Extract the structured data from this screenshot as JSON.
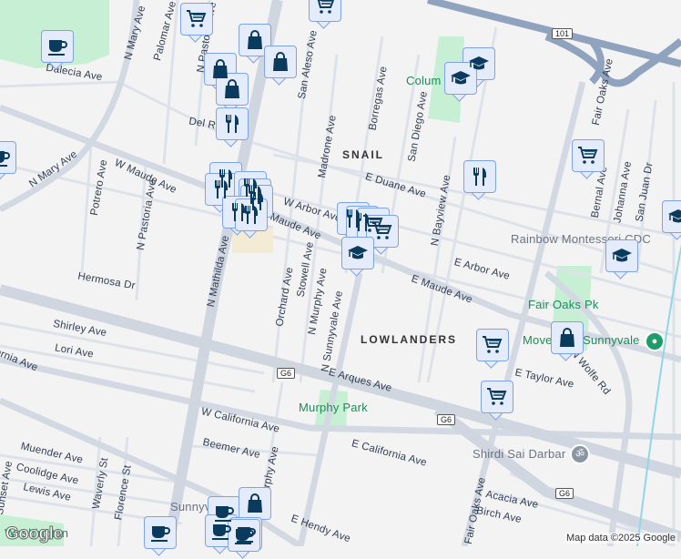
{
  "map": {
    "attribution": "Map data ©2025 Google",
    "logo": "Google"
  },
  "neighborhoods": [
    "SNAIL",
    "LOWLANDERS"
  ],
  "places": {
    "park1": "Colum",
    "park2": "Fair Oaks Pk",
    "gym": "Movement Sunnyvale",
    "park3": "Murphy Park",
    "park4": "Washington",
    "school": "Rainbow Montessori CDC",
    "temple": "Shirdi Sai Darbar",
    "town": "Sunnyvale"
  },
  "shields": [
    "101",
    "G6",
    "G6",
    "G6"
  ],
  "streets": [
    "N Mary Ave",
    "Palomar Ave",
    "N Pastoria Ave",
    "San Aleso Ave",
    "Dalecia Ave",
    "Del Rey Ave",
    "W Maude Ave",
    "Potrero Ave",
    "N Pastoria Ave",
    "W Arbor Ave",
    "Madrone Ave",
    "Borregas Ave",
    "San Diego Ave",
    "E Duane Ave",
    "N Bayview Ave",
    "Fair Oaks Ave",
    "Bernal Ave",
    "Johanna Ave",
    "San Juan Dr",
    "E Arbor Ave",
    "E Maude Ave",
    "E Taylor Ave",
    "N Wolfe Rd",
    "E Arques Ave",
    "E California Ave",
    "Acacia Ave",
    "Birch Ave",
    "Fair Oaks Ave",
    "Hermosa Dr",
    "Shirley Ave",
    "Lori Ave",
    "California Ave",
    "W California Ave",
    "Beemer Ave",
    "Muender Ave",
    "Coolidge Ave",
    "Lewis Ave",
    "Waverly St",
    "Florence St",
    "Sunset Ave",
    "N Mathilda Ave",
    "Orchard Ave",
    "Stowell Ave",
    "N Murphy Ave",
    "N Sunnyvale Ave",
    "Murphy Ave",
    "E Hendy Ave",
    "N Mary Ave",
    "Maude Ave"
  ],
  "markers": [
    {
      "icon": "cup"
    },
    {
      "icon": "cart"
    },
    {
      "icon": "bag"
    },
    {
      "icon": "bag"
    },
    {
      "icon": "bag"
    },
    {
      "icon": "bag"
    },
    {
      "icon": "cutlery"
    },
    {
      "icon": "cutlery"
    },
    {
      "icon": "cutlery"
    },
    {
      "icon": "cutlery"
    },
    {
      "icon": "cutlery"
    },
    {
      "icon": "cutlery"
    },
    {
      "icon": "cutlery"
    },
    {
      "icon": "cutlery"
    },
    {
      "icon": "cup"
    },
    {
      "icon": "cart"
    },
    {
      "icon": "cap"
    },
    {
      "icon": "cap"
    },
    {
      "icon": "cutlery"
    },
    {
      "icon": "cart"
    },
    {
      "icon": "cap"
    },
    {
      "icon": "cap"
    },
    {
      "icon": "cutlery"
    },
    {
      "icon": "cutlery"
    },
    {
      "icon": "cart"
    },
    {
      "icon": "cart"
    },
    {
      "icon": "cap"
    },
    {
      "icon": "cart"
    },
    {
      "icon": "bag"
    },
    {
      "icon": "cart"
    },
    {
      "icon": "cup"
    },
    {
      "icon": "cup"
    },
    {
      "icon": "bag"
    },
    {
      "icon": "cup"
    },
    {
      "icon": "cup"
    },
    {
      "icon": "cup"
    }
  ],
  "colors": {
    "marker_bg": "#e4ecfc",
    "marker_border": "#7ea2e6",
    "icon": "#0b3b5c",
    "park": "#c6efd3",
    "highway": "#8fa3bf"
  }
}
